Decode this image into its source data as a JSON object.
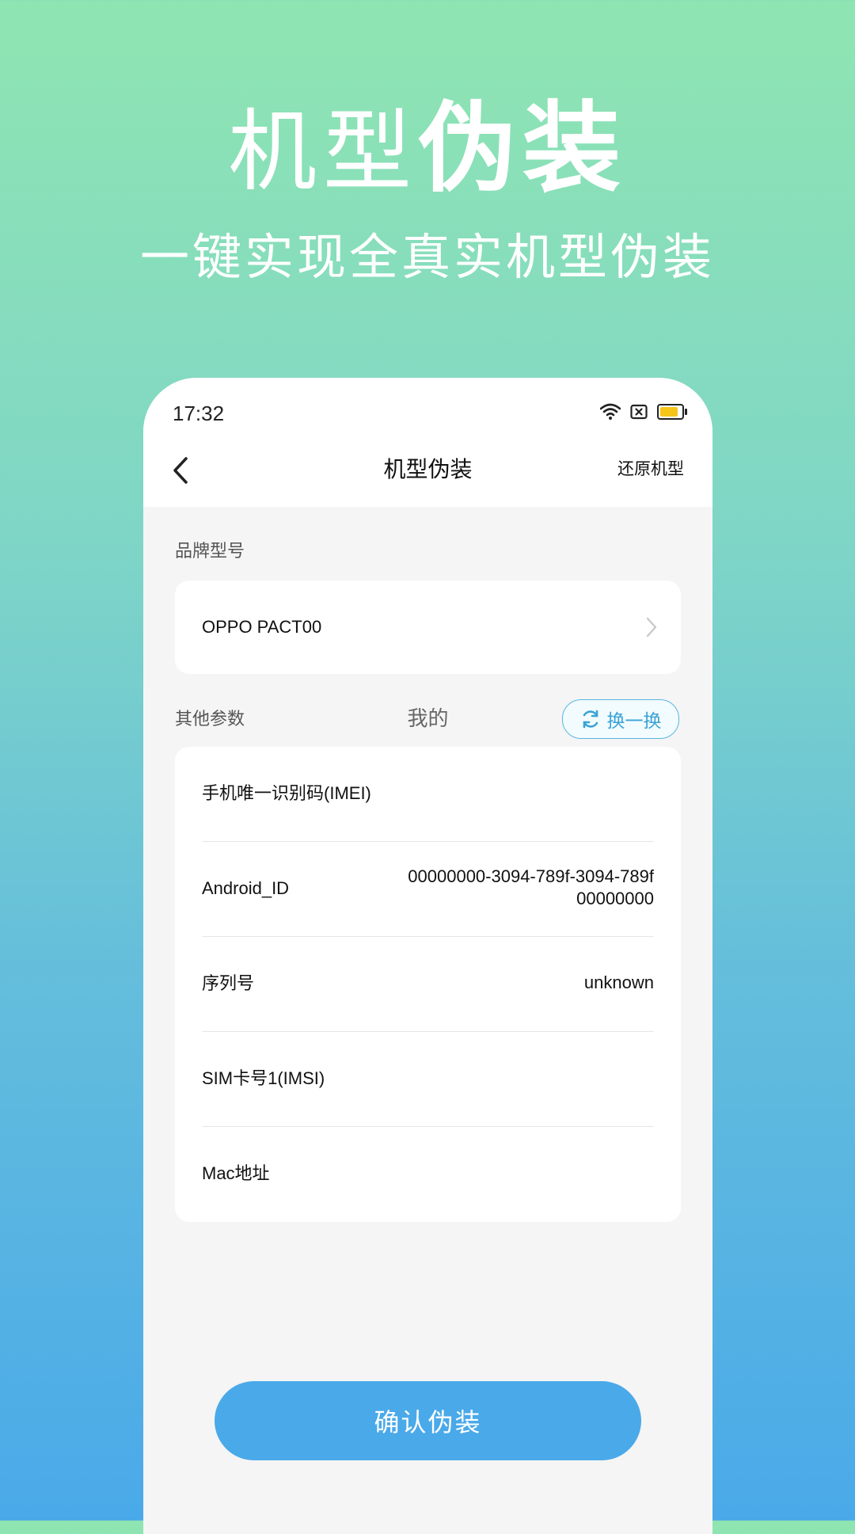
{
  "hero": {
    "title_light": "机型",
    "title_bold": "伪装",
    "subtitle": "一键实现全真实机型伪装"
  },
  "status_bar": {
    "time": "17:32",
    "battery_level": 0.85,
    "battery_color": "#f5c518"
  },
  "nav": {
    "back_icon": "chevron-left-icon",
    "title": "机型伪装",
    "restore_label": "还原机型"
  },
  "brand_section": {
    "label": "品牌型号",
    "value": "OPPO PACT00"
  },
  "params_section": {
    "label": "其他参数",
    "tab_label": "我的",
    "swap_label": "换一换",
    "rows": [
      {
        "label": "手机唯一识别码(IMEI)",
        "value": ""
      },
      {
        "label": "Android_ID",
        "value": "00000000-3094-789f-3094-789f00000000"
      },
      {
        "label": "序列号",
        "value": "unknown"
      },
      {
        "label": "SIM卡号1(IMSI)",
        "value": ""
      },
      {
        "label": "Mac地址",
        "value": ""
      }
    ]
  },
  "confirm_button": {
    "label": "确认伪装"
  },
  "colors": {
    "accent": "#4aa9e9",
    "swap_border": "#5ab7e0",
    "gradient_top": "#8fe5b1",
    "gradient_bottom": "#4aa9e9"
  }
}
